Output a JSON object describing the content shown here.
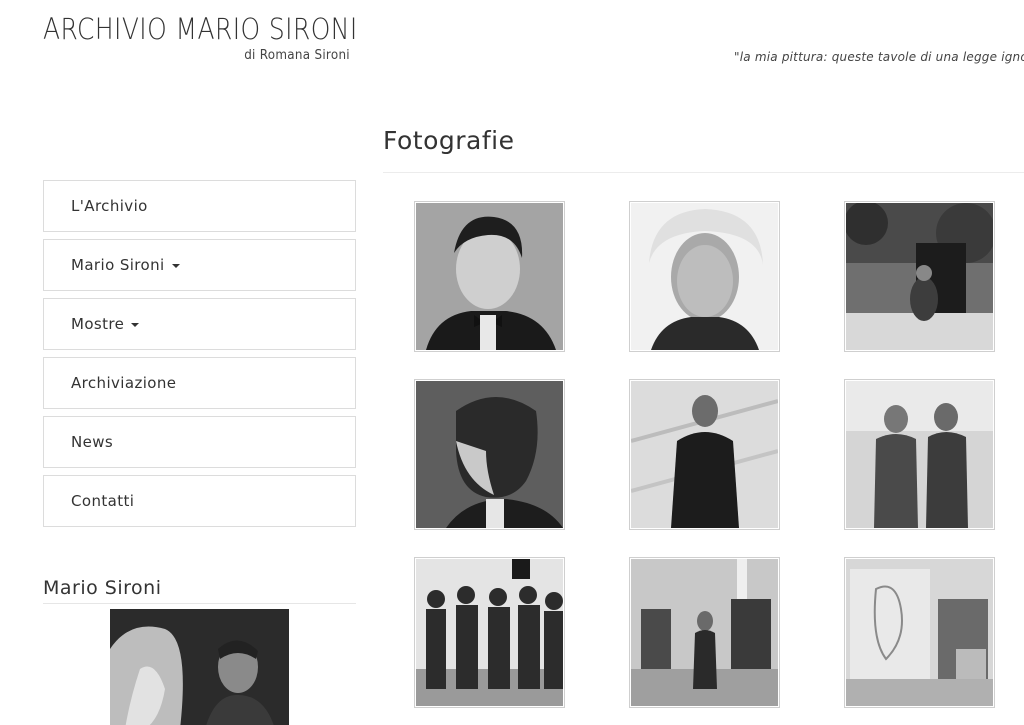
{
  "header": {
    "title": "ARCHIVIO MARIO SIRONI",
    "subtitle": "di Romana Sironi",
    "quote": "\"la mia pittura: queste tavole di una legge ignota"
  },
  "nav": {
    "items": [
      {
        "label": "L'Archivio",
        "dropdown": false
      },
      {
        "label": "Mario Sironi",
        "dropdown": true
      },
      {
        "label": "Mostre",
        "dropdown": true
      },
      {
        "label": "Archiviazione",
        "dropdown": false
      },
      {
        "label": "News",
        "dropdown": false
      },
      {
        "label": "Contatti",
        "dropdown": false
      }
    ]
  },
  "sidebar": {
    "heading": "Mario Sironi"
  },
  "main": {
    "heading": "Fotografie",
    "gallery_photo_count": 9
  },
  "colors": {
    "text": "#333333",
    "border": "#dcdcdc",
    "photo_tint": "#2a2a2a"
  }
}
